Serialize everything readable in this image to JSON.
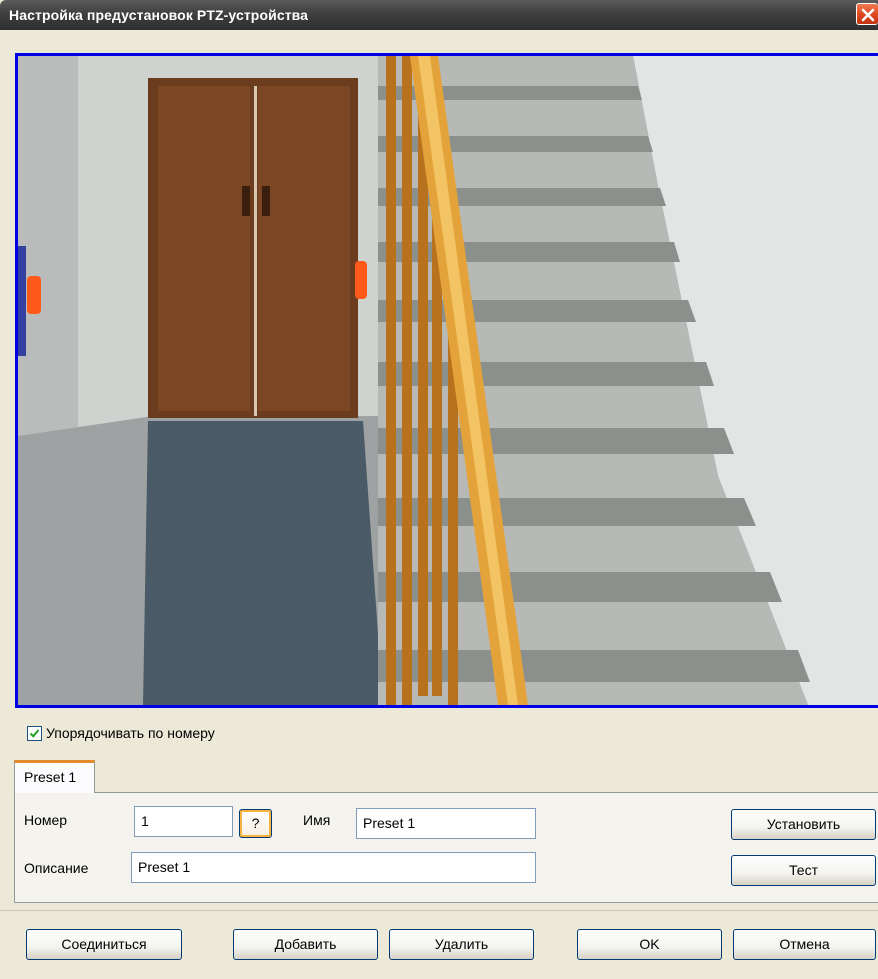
{
  "window": {
    "title": "Настройка предустановок PTZ-устройства",
    "accent_color": "#0000e6",
    "close_icon": "close-icon"
  },
  "sort": {
    "label": "Упорядочивать по номеру",
    "checked": true
  },
  "tabs": [
    {
      "label": "Preset 1",
      "selected": true
    }
  ],
  "preset": {
    "number_label": "Номер",
    "number_value": "1",
    "help_label": "?",
    "name_label": "Имя",
    "name_value": "Preset 1",
    "description_label": "Описание",
    "description_value": "Preset 1",
    "set_label": "Установить",
    "test_label": "Тест"
  },
  "footer": {
    "connect_label": "Соединиться",
    "add_label": "Добавить",
    "delete_label": "Удалить",
    "ok_label": "OK",
    "cancel_label": "Отмена"
  }
}
